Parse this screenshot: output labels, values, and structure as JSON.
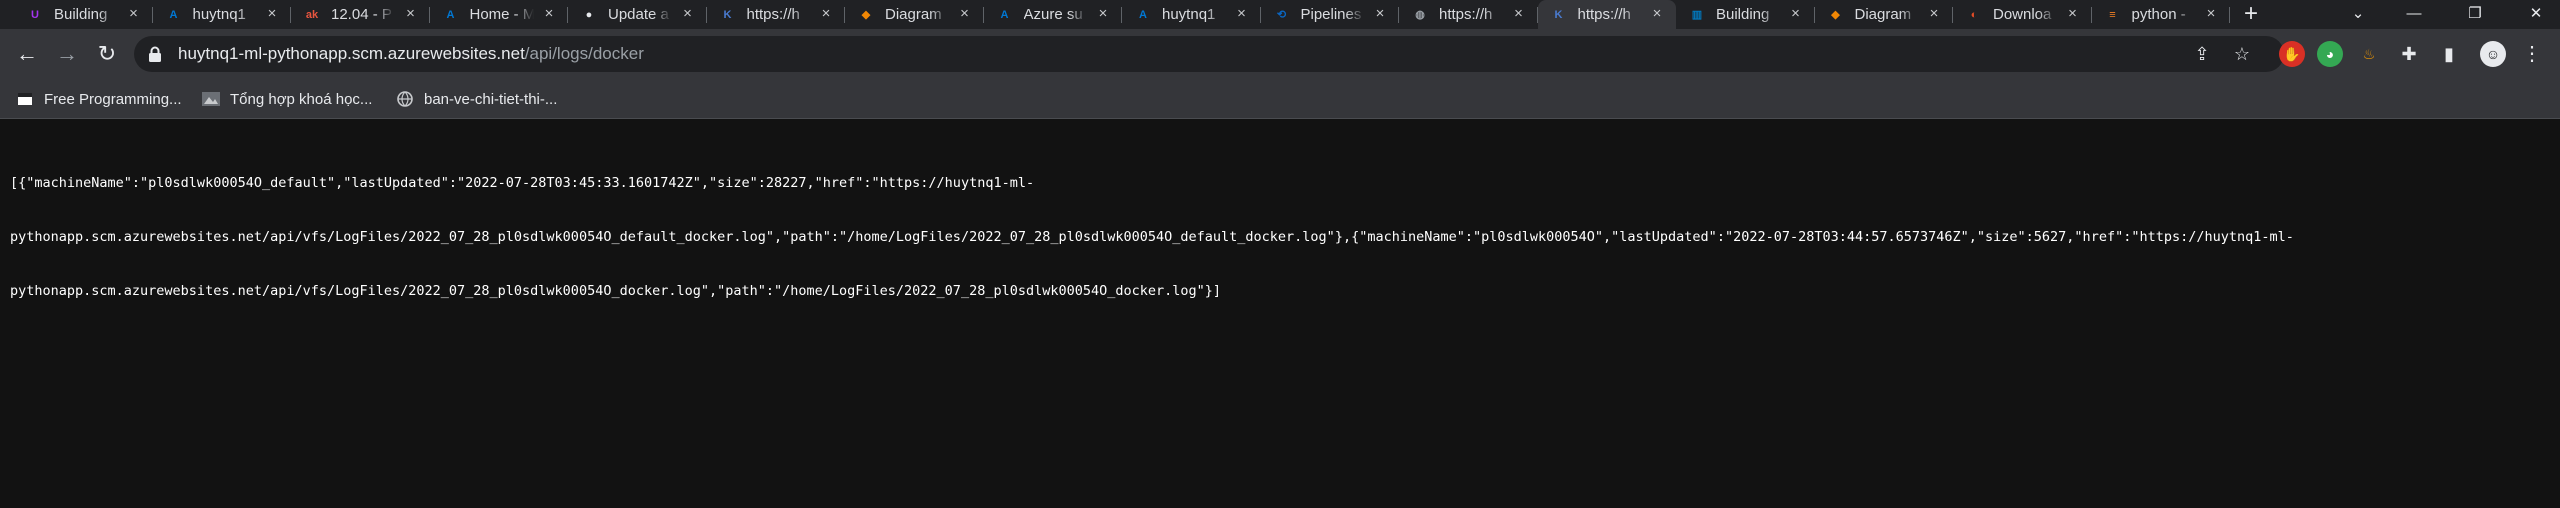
{
  "tabs": [
    {
      "title": "Building",
      "icon": "udemy-icon",
      "color": "#a435f0",
      "glyph": "U",
      "active": false
    },
    {
      "title": "huytnq1",
      "icon": "azure-icon",
      "color": "#0078d4",
      "glyph": "A",
      "active": false
    },
    {
      "title": "12.04 - P",
      "icon": "app-icon",
      "color": "#e8553f",
      "glyph": "ak",
      "active": false
    },
    {
      "title": "Home - M",
      "icon": "azure-icon",
      "color": "#0078d4",
      "glyph": "A",
      "active": false
    },
    {
      "title": "Update a",
      "icon": "github-icon",
      "color": "#e8eaed",
      "glyph": "●",
      "active": false
    },
    {
      "title": "https://h",
      "icon": "kudu-icon",
      "color": "#4a7bd0",
      "glyph": "K",
      "active": false
    },
    {
      "title": "Diagram",
      "icon": "drawio-icon",
      "color": "#f08705",
      "glyph": "◆",
      "active": false
    },
    {
      "title": "Azure su",
      "icon": "azure-icon",
      "color": "#0078d4",
      "glyph": "A",
      "active": false
    },
    {
      "title": "huytnq1",
      "icon": "azure-icon",
      "color": "#0078d4",
      "glyph": "A",
      "active": false
    },
    {
      "title": "Pipelines",
      "icon": "azure-devops-icon",
      "color": "#0a66c2",
      "glyph": "⟲",
      "active": false
    },
    {
      "title": "https://h",
      "icon": "globe-icon",
      "color": "#9aa0a6",
      "glyph": "◍",
      "active": false
    },
    {
      "title": "https://h",
      "icon": "kudu-icon",
      "color": "#4a7bd0",
      "glyph": "K",
      "active": true
    },
    {
      "title": "Building",
      "icon": "trello-icon",
      "color": "#0079bf",
      "glyph": "▥",
      "active": false
    },
    {
      "title": "Diagram",
      "icon": "drawio-icon",
      "color": "#f08705",
      "glyph": "◆",
      "active": false
    },
    {
      "title": "Downloa",
      "icon": "download-site-icon",
      "color": "#e34c26",
      "glyph": "◐",
      "active": false
    },
    {
      "title": "python -",
      "icon": "stackoverflow-icon",
      "color": "#f48024",
      "glyph": "≡",
      "active": false
    }
  ],
  "address": {
    "host": "huytnq1-ml-pythonapp.scm.azurewebsites.net",
    "path": "/api/logs/docker"
  },
  "bookmarks": [
    {
      "label": "Free Programming...",
      "icon": "page-icon"
    },
    {
      "label": "Tổng hợp khoá học...",
      "icon": "bookmark-image-icon"
    },
    {
      "label": "ban-ve-chi-tiet-thi-...",
      "icon": "globe-icon"
    }
  ],
  "content": {
    "json_text": "[{\"machineName\":\"pl0sdlwk00054O_default\",\"lastUpdated\":\"2022-07-28T03:45:33.1601742Z\",\"size\":28227,\"href\":\"https://huytnq1-ml-pythonapp.scm.azurewebsites.net/api/vfs/LogFiles/2022_07_28_pl0sdlwk00054O_default_docker.log\",\"path\":\"/home/LogFiles/2022_07_28_pl0sdlwk00054O_default_docker.log\"},{\"machineName\":\"pl0sdlwk00054O\",\"lastUpdated\":\"2022-07-28T03:44:57.6573746Z\",\"size\":5627,\"href\":\"https://huytnq1-ml-pythonapp.scm.azurewebsites.net/api/vfs/LogFiles/2022_07_28_pl0sdlwk00054O_docker.log\",\"path\":\"/home/LogFiles/2022_07_28_pl0sdlwk00054O_docker.log\"}]",
    "json_line_1": "[{\"machineName\":\"pl0sdlwk00054O_default\",\"lastUpdated\":\"2022-07-28T03:45:33.1601742Z\",\"size\":28227,\"href\":\"https://huytnq1-ml-",
    "json_line_2": "pythonapp.scm.azurewebsites.net/api/vfs/LogFiles/2022_07_28_pl0sdlwk00054O_default_docker.log\",\"path\":\"/home/LogFiles/2022_07_28_pl0sdlwk00054O_default_docker.log\"},{\"machineName\":\"pl0sdlwk00054O\",\"lastUpdated\":\"2022-07-28T03:44:57.6573746Z\",\"size\":5627,\"href\":\"https://huytnq1-ml-",
    "json_line_3": "pythonapp.scm.azurewebsites.net/api/vfs/LogFiles/2022_07_28_pl0sdlwk00054O_docker.log\",\"path\":\"/home/LogFiles/2022_07_28_pl0sdlwk00054O_docker.log\"}]"
  },
  "colors": {
    "tabstrip": "#202124",
    "toolbar": "#35363a",
    "page_background": "#121212"
  }
}
